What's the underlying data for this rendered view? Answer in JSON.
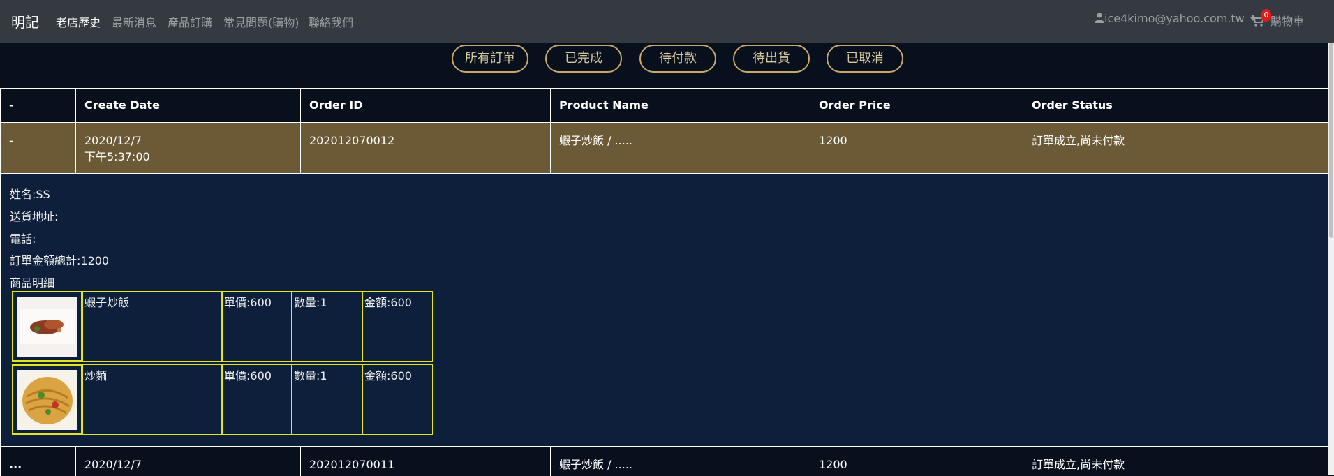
{
  "nav": {
    "brand": "明記",
    "links": [
      "老店歷史",
      "最新消息",
      "產品訂購",
      "常見問題(購物)",
      "聯絡我們"
    ],
    "user_email": "ice4kimo@yahoo.com.tw",
    "cart_count": "0",
    "cart_label": "購物車"
  },
  "filters": [
    "所有訂單",
    "已完成",
    "待付款",
    "待出貨",
    "已取消"
  ],
  "table": {
    "headers": [
      "-",
      "Create Date",
      "Order ID",
      "Product Name",
      "Order Price",
      "Order Status"
    ],
    "rows": [
      {
        "toggle": "-",
        "date": "2020/12/7",
        "time": "下午5:37:00",
        "order_id": "202012070012",
        "product": "蝦子炒飯 / .....",
        "price": "1200",
        "status": "訂單成立,尚未付款"
      },
      {
        "toggle": "...",
        "date": "2020/12/7",
        "order_id": "202012070011",
        "product": "蝦子炒飯 / .....",
        "price": "1200",
        "status": "訂單成立,尚未付款"
      }
    ]
  },
  "detail": {
    "name": "姓名:SS",
    "address": "送貨地址:",
    "phone": "電話:",
    "total": "訂單金額總計:1200",
    "items_title": "商品明細",
    "items": [
      {
        "name": "蝦子炒飯",
        "unit_price": "單價:600",
        "qty": "數量:1",
        "amount": "金額:600",
        "image": "shrimp-fried-rice-photo"
      },
      {
        "name": "炒麵",
        "unit_price": "單價:600",
        "qty": "數量:1",
        "amount": "金額:600",
        "image": "fried-noodles-photo"
      }
    ]
  },
  "colors": {
    "navbar": "#343a40",
    "page_bg": "#07101c",
    "selected_row": "#6b5a35",
    "detail_bg": "#0d1f3a",
    "accent_gold": "#c9a86a",
    "item_border": "#e3e320",
    "badge": "#e01b1b"
  }
}
